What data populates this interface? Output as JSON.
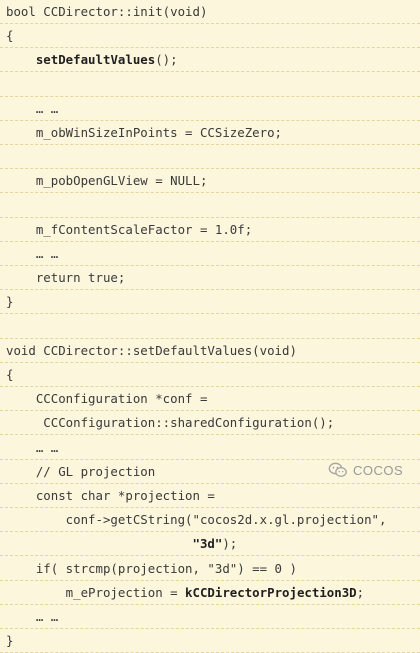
{
  "code": {
    "lines": [
      "bool CCDirector::init(void)",
      "{",
      "    setDefaultValues();",
      "",
      "    … …",
      "    m_obWinSizeInPoints = CCSizeZero;",
      "",
      "    m_pobOpenGLView = NULL;",
      "",
      "    m_fContentScaleFactor = 1.0f;",
      "    … …",
      "    return true;",
      "}",
      "",
      "void CCDirector::setDefaultValues(void)",
      "{",
      "    CCConfiguration *conf =",
      "     CCConfiguration::sharedConfiguration();",
      "    … …",
      "    // GL projection",
      "    const char *projection =",
      "        conf->getCString(\"cocos2d.x.gl.projection\",",
      "                         \"3d\");",
      "    if( strcmp(projection, \"3d\") == 0 )",
      "        m_eProjection = kCCDirectorProjection3D;",
      "    … …",
      "}"
    ],
    "bold_segments": [
      {
        "line": 2,
        "text": "setDefaultValues"
      },
      {
        "line": 22,
        "text": "\"3d\""
      },
      {
        "line": 24,
        "text": "kCCDirectorProjection3D"
      }
    ]
  },
  "watermark": {
    "text": "COCOS",
    "icon": "wechat-icon"
  },
  "colors": {
    "background": "#fbf6dc",
    "rule": "#e3d79c",
    "text": "#3a3a3a"
  }
}
